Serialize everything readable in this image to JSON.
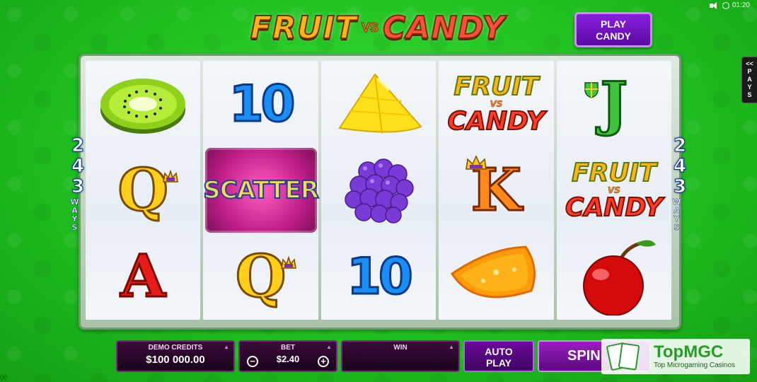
{
  "title": {
    "word1": "FRUIT",
    "vs": "VS",
    "word2": "CANDY"
  },
  "play_candy_button": {
    "line1": "PLAY",
    "line2": "CANDY"
  },
  "status": {
    "time": "01:20"
  },
  "pays_tab": {
    "arrows": "<<",
    "letters": [
      "P",
      "A",
      "Y",
      "S"
    ]
  },
  "ways_left": {
    "digits": [
      "2",
      "4",
      "3"
    ],
    "label": "WAYS"
  },
  "ways_right": {
    "digits": [
      "2",
      "4",
      "3"
    ],
    "label": "WAYS"
  },
  "reels": [
    [
      {
        "symbol": "kiwi"
      },
      {
        "symbol": "queen",
        "text": "Q"
      },
      {
        "symbol": "ace",
        "text": "A"
      }
    ],
    [
      {
        "symbol": "ten",
        "text": "10"
      },
      {
        "symbol": "scatter",
        "text": "SCATTER"
      },
      {
        "symbol": "queen",
        "text": "Q"
      }
    ],
    [
      {
        "symbol": "pineapple"
      },
      {
        "symbol": "grapes"
      },
      {
        "symbol": "ten",
        "text": "10"
      }
    ],
    [
      {
        "symbol": "wild-logo",
        "text1": "FRUIT",
        "text2": "VS",
        "text3": "CANDY"
      },
      {
        "symbol": "king",
        "text": "K"
      },
      {
        "symbol": "orange"
      }
    ],
    [
      {
        "symbol": "jack",
        "text": "J"
      },
      {
        "symbol": "wild-logo",
        "text1": "FRUIT",
        "text2": "VS",
        "text3": "CANDY"
      },
      {
        "symbol": "cherry"
      }
    ]
  ],
  "bottom": {
    "credits": {
      "label": "DEMO CREDITS",
      "value": "$100 000.00"
    },
    "bet": {
      "label": "BET",
      "value": "$2.40",
      "minus": "−",
      "plus": "+"
    },
    "win": {
      "label": "WIN",
      "value": ""
    },
    "autoplay": {
      "line1": "AUTO",
      "line2": "PLAY"
    },
    "spin": {
      "label": "SPIN"
    }
  },
  "watermark": {
    "title": "TopMGC",
    "subtitle": "Top Microgaming Casinos"
  },
  "edge_text": "00",
  "colors": {
    "background": "#22c422",
    "reel_frame": "#6f9a6f",
    "panel": "#2a072a",
    "accent_purple": "#6a0a9a",
    "ways_blue": "#0b2d8a"
  }
}
